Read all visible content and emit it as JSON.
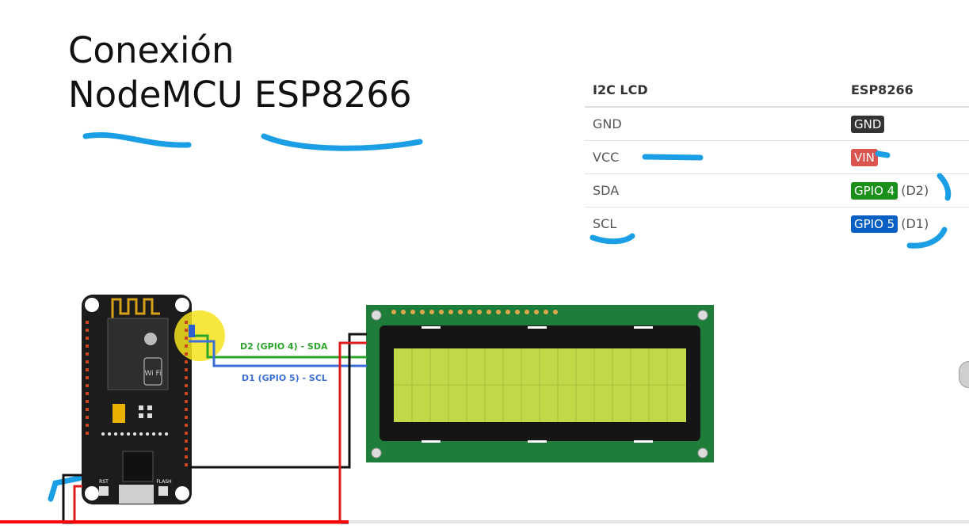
{
  "slide": {
    "title_line1": "Conexión",
    "title_line2": "NodeMCU ESP8266"
  },
  "table": {
    "headers": [
      "I2C LCD",
      "ESP8266"
    ],
    "rows": [
      {
        "lcd": "GND",
        "esp": "GND",
        "esp_color": "#333333",
        "note": ""
      },
      {
        "lcd": "VCC",
        "esp": "VIN",
        "esp_color": "#d9534f",
        "note": ""
      },
      {
        "lcd": "SDA",
        "esp": "GPIO 4",
        "esp_color": "#1a8f1a",
        "note": "(D2)"
      },
      {
        "lcd": "SCL",
        "esp": "GPIO 5",
        "esp_color": "#0a5fc4",
        "note": "(D1)"
      }
    ]
  },
  "diagram": {
    "sda_label": "D2 (GPIO 4) - SDA",
    "scl_label": "D1 (GPIO 5) - SCL",
    "board_name": "NodeMCU ESP8266",
    "rst_label": "RST",
    "flash_label": "FLASH",
    "wifi_text": "Wi Fi",
    "sda_color": "#2aa52a",
    "scl_color": "#3d6fd6",
    "power_color": "#e01b1b",
    "gnd_color": "#111111",
    "screen_color": "#c3d849"
  },
  "video": {
    "progress": 0.36
  },
  "annotations": {
    "marker_color": "#1a9fe6"
  }
}
